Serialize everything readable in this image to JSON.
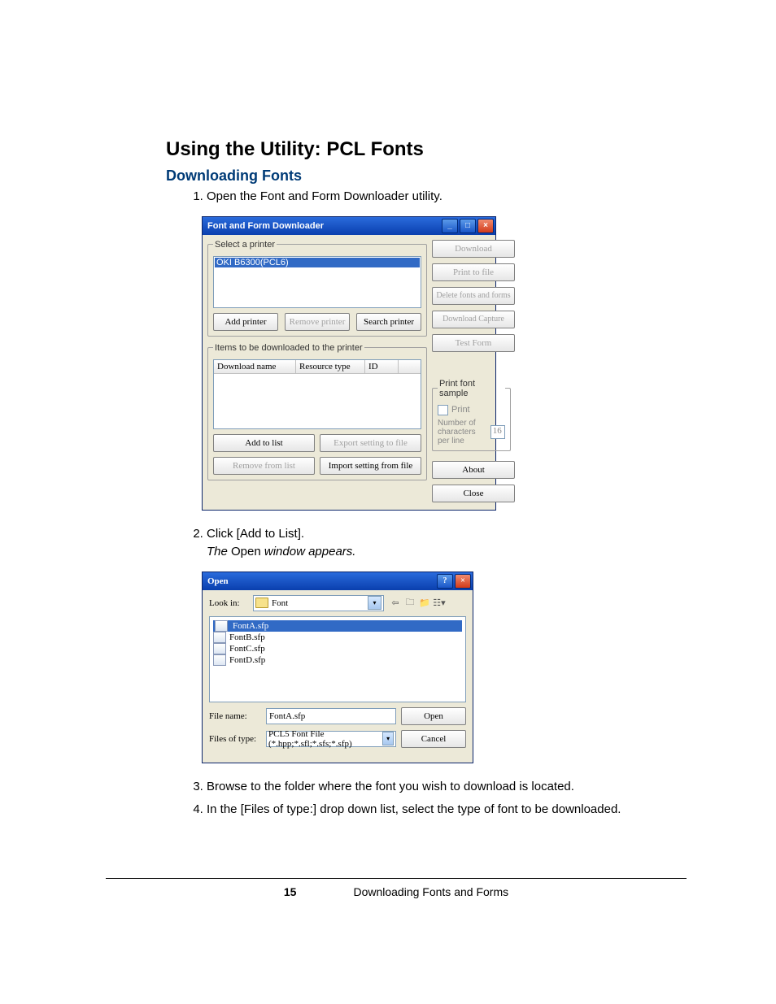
{
  "headings": {
    "h1": "Using the Utility: PCL Fonts",
    "h2": "Downloading Fonts"
  },
  "steps": {
    "s1": "Open the Font and Form Downloader utility.",
    "s2a": "Click [Add to List].",
    "s2b_pre": "The ",
    "s2b_mid": "Open",
    "s2b_post": " window appears.",
    "s3": "Browse to the folder where the font you wish to download is located.",
    "s4": "In the [Files of type:] drop down list, select the type of font to be downloaded."
  },
  "footer": {
    "page": "15",
    "section": "Downloading Fonts and Forms"
  },
  "win1": {
    "title": "Font and Form Downloader",
    "select_printer_legend": "Select a printer",
    "printer_item": "OKI B6300(PCL6)",
    "add_printer": "Add printer",
    "remove_printer": "Remove printer",
    "search_printer": "Search printer",
    "items_legend": "Items to be downloaded to the printer",
    "col_download_name": "Download name",
    "col_resource_type": "Resource type",
    "col_id": "ID",
    "add_to_list": "Add to list",
    "export_setting": "Export setting to file",
    "remove_from_list": "Remove from list",
    "import_setting": "Import setting from file",
    "btn_download": "Download",
    "btn_print_to_file": "Print to file",
    "btn_delete": "Delete fonts and forms",
    "btn_download_capture": "Download Capture",
    "btn_test_form": "Test Form",
    "pfs_legend": "Print font sample",
    "pfs_print": "Print",
    "pfs_num_label": "Number of characters per line",
    "pfs_num_value": "16",
    "btn_about": "About",
    "btn_close": "Close"
  },
  "win2": {
    "title": "Open",
    "look_in_label": "Look in:",
    "look_in_value": "Font",
    "files": [
      "FontA.sfp",
      "FontB.sfp",
      "FontC.sfp",
      "FontD.sfp"
    ],
    "file_name_label": "File name:",
    "file_name_value": "FontA.sfp",
    "files_of_type_label": "Files of type:",
    "files_of_type_value": "PCL5 Font File (*.hpp;*.sfl;*.sfs;*.sfp)",
    "open_btn": "Open",
    "cancel_btn": "Cancel"
  }
}
